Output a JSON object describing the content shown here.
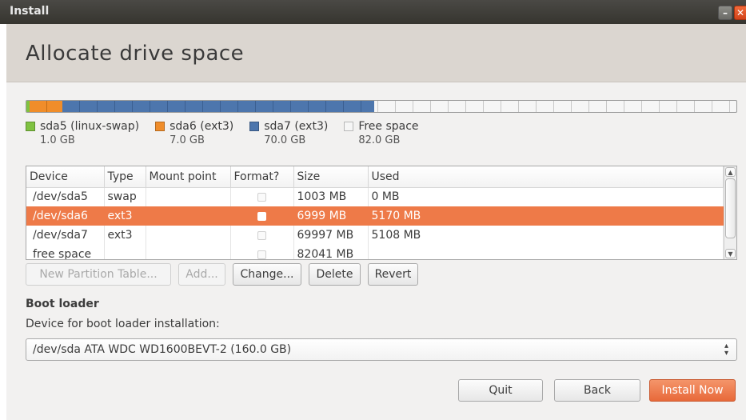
{
  "window": {
    "title": "Install"
  },
  "header": {
    "title": "Allocate drive space"
  },
  "colors": {
    "sda5": "#7fc241",
    "sda6": "#f08d2a",
    "sda7": "#4d76ad",
    "free": "#f6f6f6",
    "selection": "#ee7a48",
    "accent": "#e8693a"
  },
  "legend": [
    {
      "name": "sda5 (linux-swap)",
      "size": "1.0 GB",
      "color": "#7fc241"
    },
    {
      "name": "sda6 (ext3)",
      "size": "7.0 GB",
      "color": "#f08d2a"
    },
    {
      "name": "sda7 (ext3)",
      "size": "70.0 GB",
      "color": "#4d76ad"
    },
    {
      "name": "Free space",
      "size": "82.0 GB",
      "color": "#f6f6f6"
    }
  ],
  "table": {
    "columns": [
      "Device",
      "Type",
      "Mount point",
      "Format?",
      "Size",
      "Used"
    ],
    "rows": [
      {
        "device": "/dev/sda5",
        "type": "swap",
        "mount": "",
        "format": false,
        "size": "1003 MB",
        "used": "0 MB"
      },
      {
        "device": "/dev/sda6",
        "type": "ext3",
        "mount": "",
        "format": false,
        "size": "6999 MB",
        "used": "5170 MB"
      },
      {
        "device": "/dev/sda7",
        "type": "ext3",
        "mount": "",
        "format": false,
        "size": "69997 MB",
        "used": "5108 MB"
      },
      {
        "device": "free space",
        "type": "",
        "mount": "",
        "format": false,
        "size": "82041 MB",
        "used": ""
      }
    ]
  },
  "actions": {
    "new_partition_table": "New Partition Table...",
    "add": "Add...",
    "change": "Change...",
    "delete": "Delete",
    "revert": "Revert"
  },
  "bootloader": {
    "title": "Boot loader",
    "label": "Device for boot loader installation:",
    "selected": "/dev/sda ATA WDC WD1600BEVT-2 (160.0 GB)"
  },
  "footer": {
    "quit": "Quit",
    "back": "Back",
    "install": "Install Now"
  }
}
